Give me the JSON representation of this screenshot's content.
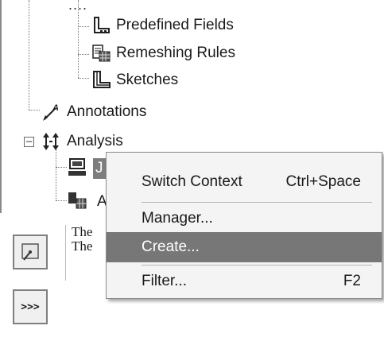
{
  "tree": {
    "ellipsis": "....",
    "items": [
      {
        "label": "Predefined Fields"
      },
      {
        "label": "Remeshing Rules"
      },
      {
        "label": "Sketches"
      },
      {
        "label": "Annotations"
      },
      {
        "label": "Analysis",
        "expander": "−"
      }
    ],
    "selected_fragment": "J",
    "partial_fragment": "A"
  },
  "message_area": {
    "line1": "The",
    "line2": "The"
  },
  "toolbar": {
    "expand_label": ">>>"
  },
  "context_menu": {
    "items": [
      {
        "label": "Switch Context",
        "shortcut": "Ctrl+Space"
      },
      {
        "label": "Manager...",
        "shortcut": ""
      },
      {
        "label": "Create...",
        "shortcut": ""
      },
      {
        "label": "Filter...",
        "shortcut": "F2"
      }
    ],
    "highlighted_item": "Create..."
  },
  "colors": {
    "highlight": "#777777",
    "menu_background": "#f4f4f4",
    "selected_node": "#7d7d7d"
  }
}
